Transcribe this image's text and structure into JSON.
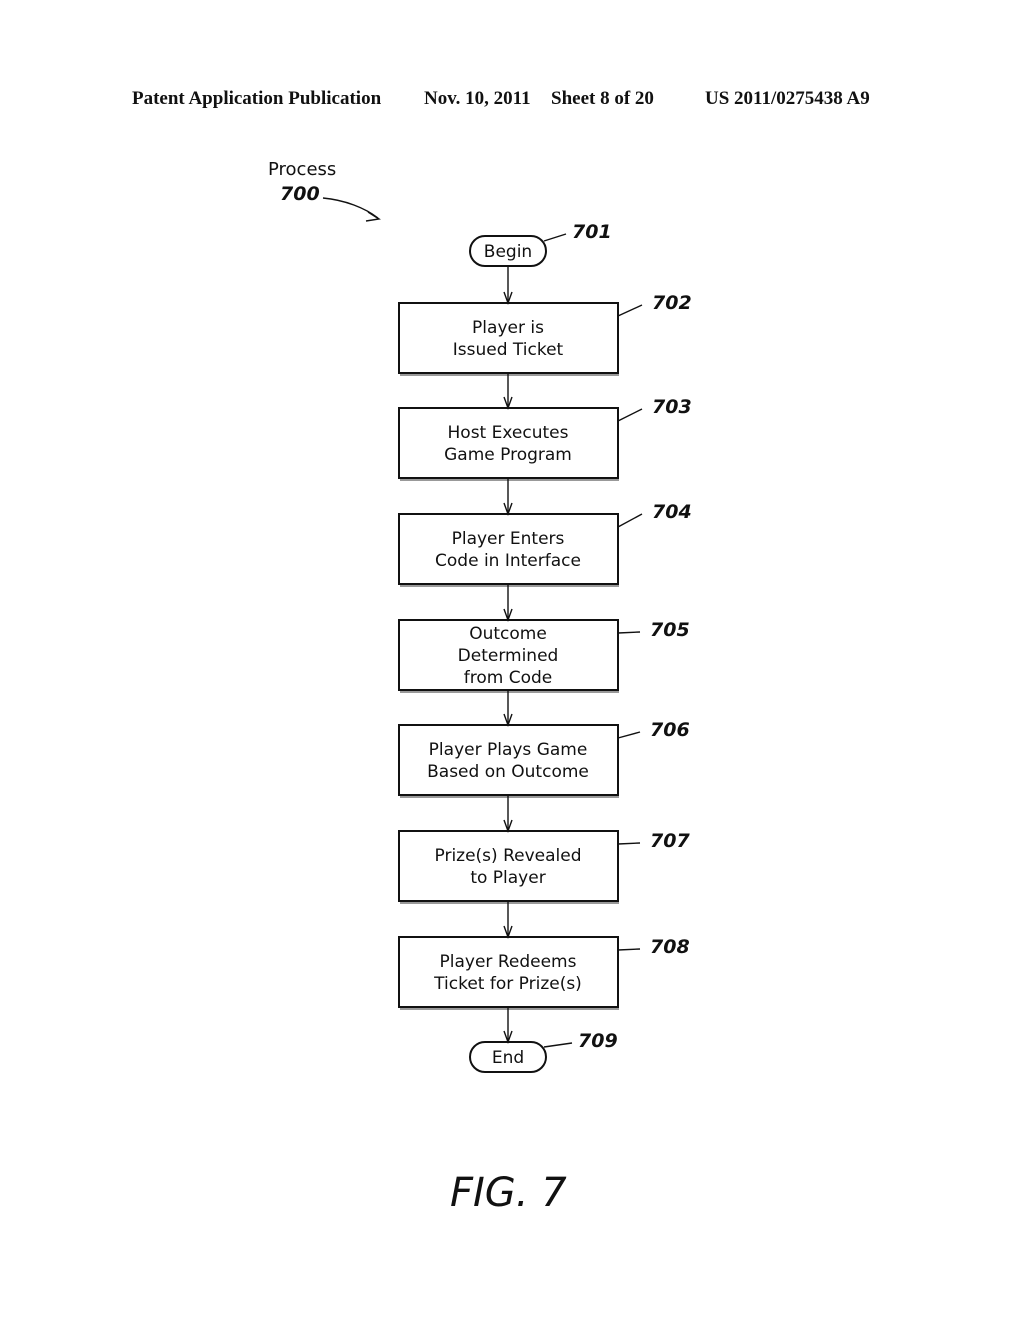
{
  "header": {
    "publication": "Patent Application Publication",
    "date": "Nov. 10, 2011",
    "sheet": "Sheet 8 of 20",
    "number": "US 2011/0275438 A9"
  },
  "process": {
    "label": "Process",
    "ref": "700"
  },
  "nodes": [
    {
      "ref": "701",
      "type": "terminal",
      "lines": [
        "Begin"
      ]
    },
    {
      "ref": "702",
      "type": "process",
      "lines": [
        "Player  is",
        "Issued  Ticket"
      ]
    },
    {
      "ref": "703",
      "type": "process",
      "lines": [
        "Host  Executes",
        "Game  Program"
      ]
    },
    {
      "ref": "704",
      "type": "process",
      "lines": [
        "Player  Enters",
        "Code  in  Interface"
      ]
    },
    {
      "ref": "705",
      "type": "process",
      "lines": [
        "Outcome",
        "Determined",
        "from  Code"
      ]
    },
    {
      "ref": "706",
      "type": "process",
      "lines": [
        "Player  Plays  Game",
        "Based  on  Outcome"
      ]
    },
    {
      "ref": "707",
      "type": "process",
      "lines": [
        "Prize(s)  Revealed",
        "to  Player"
      ]
    },
    {
      "ref": "708",
      "type": "process",
      "lines": [
        "Player  Redeems",
        "Ticket  for  Prize(s)"
      ]
    },
    {
      "ref": "709",
      "type": "terminal",
      "lines": [
        "End"
      ]
    }
  ],
  "figure_label": "FIG.  7"
}
